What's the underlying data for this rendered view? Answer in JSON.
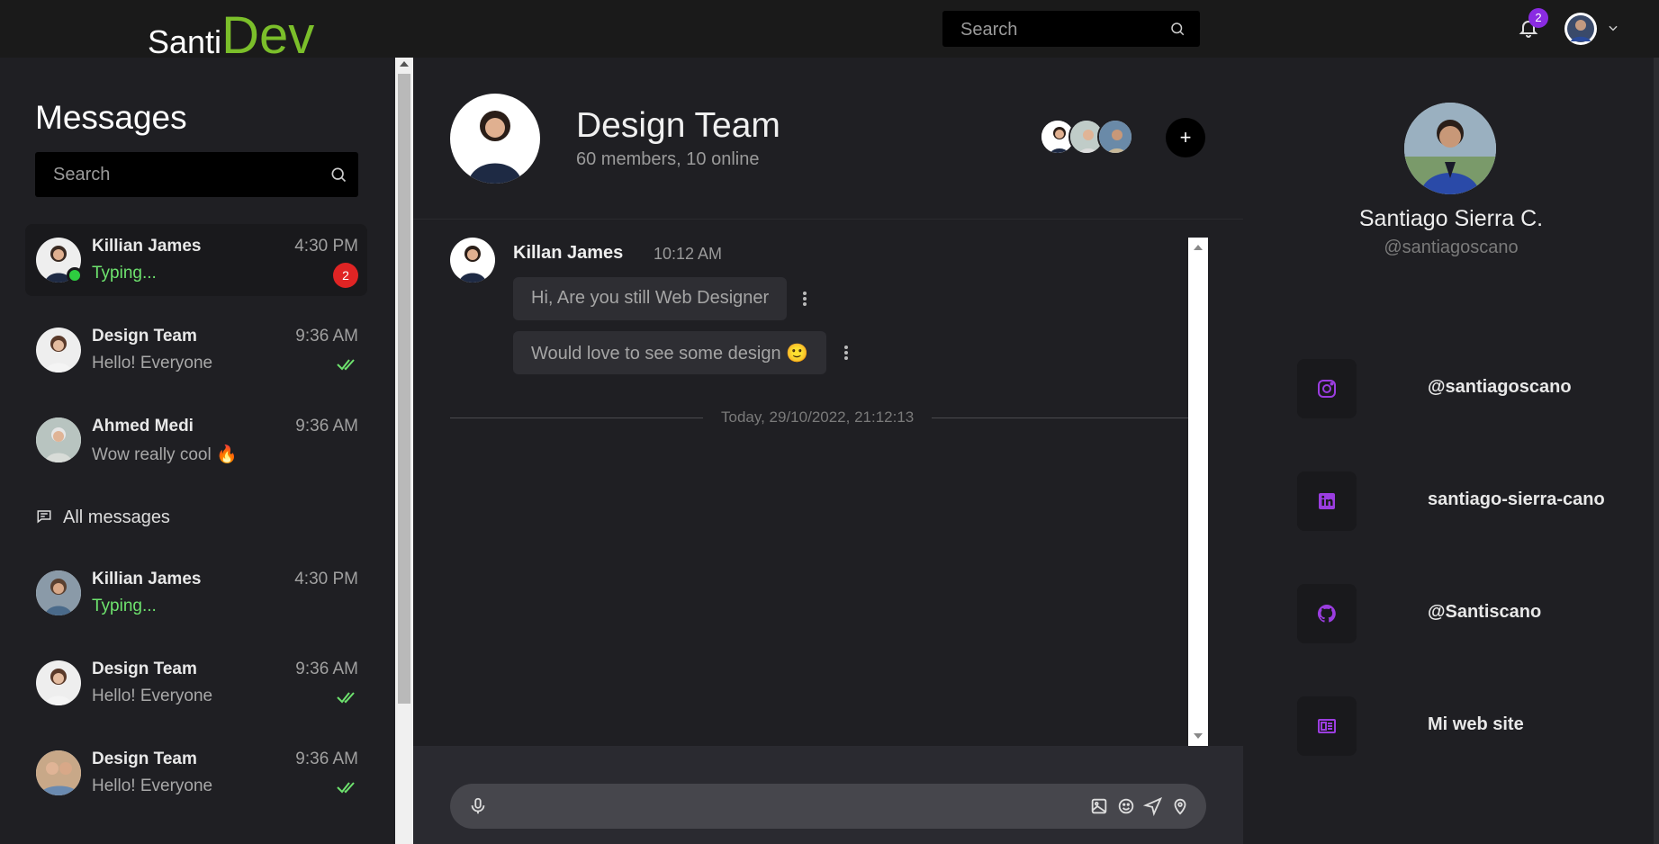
{
  "app": {
    "logo_part1": "Santi",
    "logo_part2": "Dev",
    "search_placeholder": "Search",
    "notifications_count": "2",
    "accent_color": "#7bbf2a",
    "badge_color": "#8a2be2"
  },
  "sidebar": {
    "title": "Messages",
    "search_placeholder": "Search",
    "conversations": [
      {
        "name": "Killian James",
        "message": "Typing...",
        "time": "4:30 PM",
        "unread": "2",
        "typing": true,
        "online": true
      },
      {
        "name": "Design Team",
        "message": "Hello! Everyone",
        "time": "9:36 AM",
        "read": true
      },
      {
        "name": "Ahmed Medi",
        "message": "Wow really cool 🔥",
        "time": "9:36 AM"
      }
    ],
    "all_messages_label": "All messages",
    "all_conversations": [
      {
        "name": "Killian James",
        "message": "Typing...",
        "time": "4:30 PM",
        "typing": true
      },
      {
        "name": "Design Team",
        "message": "Hello! Everyone",
        "time": "9:36 AM",
        "read": true
      },
      {
        "name": "Design Team",
        "message": "Hello! Everyone",
        "time": "9:36 AM",
        "read": true
      }
    ]
  },
  "chat": {
    "group_name": "Design Team",
    "group_subtitle": "60 members, 10 online",
    "add_label": "+",
    "messages": [
      {
        "sender": "Killan James",
        "time": "10:12 AM",
        "bubbles": [
          "Hi, Are you still Web Designer",
          "Would love to see some design 🙂"
        ]
      }
    ],
    "divider": "Today, 29/10/2022, 21:12:13"
  },
  "profile": {
    "name": "Santiago Sierra C.",
    "handle": "@santiagoscano",
    "links": [
      {
        "icon": "instagram-icon",
        "label": "@santiagoscano"
      },
      {
        "icon": "linkedin-icon",
        "label": "santiago-sierra-cano"
      },
      {
        "icon": "github-icon",
        "label": "@Santiscano"
      },
      {
        "icon": "website-icon",
        "label": "Mi web site"
      }
    ],
    "icon_color": "#9b3de0"
  }
}
